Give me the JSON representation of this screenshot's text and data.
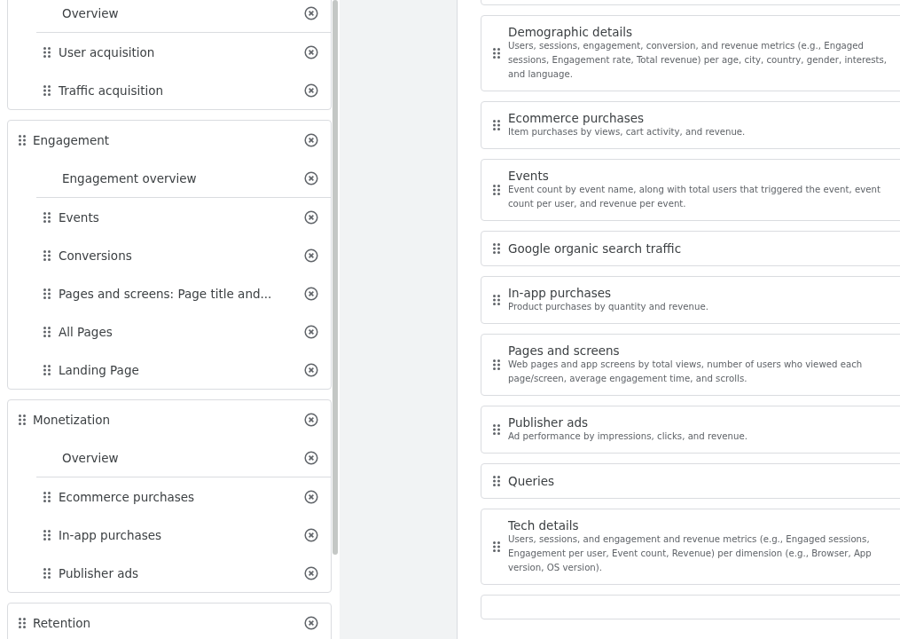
{
  "left_panel": {
    "groups": [
      {
        "items": [
          {
            "label": "Overview",
            "kind": "overview"
          },
          {
            "label": "User acquisition",
            "kind": "report"
          },
          {
            "label": "Traffic acquisition",
            "kind": "report"
          }
        ]
      },
      {
        "title": "Engagement",
        "items": [
          {
            "label": "Engagement overview",
            "kind": "overview"
          },
          {
            "label": "Events",
            "kind": "report"
          },
          {
            "label": "Conversions",
            "kind": "report"
          },
          {
            "label": "Pages and screens: Page title and...",
            "kind": "report"
          },
          {
            "label": "All Pages",
            "kind": "report"
          },
          {
            "label": "Landing Page",
            "kind": "report"
          }
        ]
      },
      {
        "title": "Monetization",
        "items": [
          {
            "label": "Overview",
            "kind": "overview"
          },
          {
            "label": "Ecommerce purchases",
            "kind": "report"
          },
          {
            "label": "In-app purchases",
            "kind": "report"
          },
          {
            "label": "Publisher ads",
            "kind": "report"
          }
        ]
      },
      {
        "title": "Retention"
      }
    ]
  },
  "report_library": {
    "reports": [
      {
        "title": "Demographic details",
        "description": "Users, sessions, engagement, conversion, and revenue metrics (e.g., Engaged sessions, Engagement rate, Total revenue) per age, city, country, gender, interests, and language."
      },
      {
        "title": "Ecommerce purchases",
        "description": "Item purchases by views, cart activity, and revenue."
      },
      {
        "title": "Events",
        "description": "Event count by event name, along with total users that triggered the event, event count per user, and revenue per event."
      },
      {
        "title": "Google organic search traffic"
      },
      {
        "title": "In-app purchases",
        "description": "Product purchases by quantity and revenue."
      },
      {
        "title": "Pages and screens",
        "description": "Web pages and app screens by total views, number of users who viewed each page/screen, average engagement time, and scrolls."
      },
      {
        "title": "Publisher ads",
        "description": "Ad performance by impressions, clicks, and revenue."
      },
      {
        "title": "Queries"
      },
      {
        "title": "Tech details",
        "description": "Users, sessions, and engagement and revenue metrics (e.g., Engaged sessions, Engagement per user, Event count, Revenue) per dimension (e.g., Browser, App version, OS version)."
      }
    ]
  }
}
